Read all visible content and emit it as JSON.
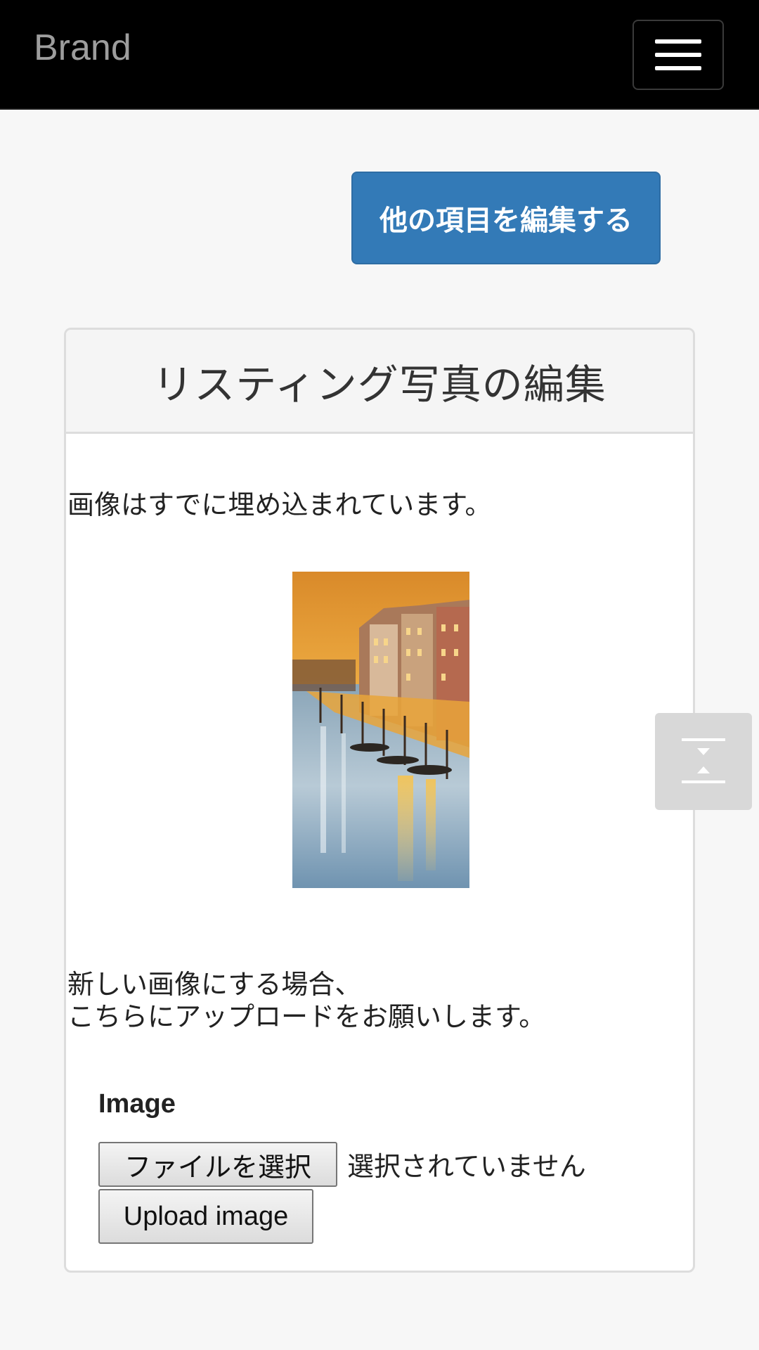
{
  "navbar": {
    "brand": "Brand",
    "menu_toggle_icon": "hamburger-menu-icon"
  },
  "actions": {
    "edit_other_label": "他の項目を編集する"
  },
  "panel": {
    "title": "リスティング写真の編集",
    "embedded_text": "画像はすでに埋め込まれています。",
    "image_description": "Venice Grand Canal at sunset",
    "upload_instructions": {
      "line1": "新しい画像にする場合、",
      "line2": "こちらにアップロードをお願いします。"
    },
    "form": {
      "image_label": "Image",
      "choose_file_label": "ファイルを選択",
      "no_file_text": "選択されていません",
      "upload_label": "Upload image"
    }
  },
  "scroll_widget": {
    "icon": "scroll-top-bottom-icon"
  },
  "colors": {
    "navbar_bg": "#000000",
    "brand_text": "#9d9d9d",
    "primary_button": "#337ab7",
    "page_bg": "#f7f7f7",
    "panel_heading_bg": "#f5f5f5",
    "scroll_widget_bg": "#d8d8d8"
  }
}
